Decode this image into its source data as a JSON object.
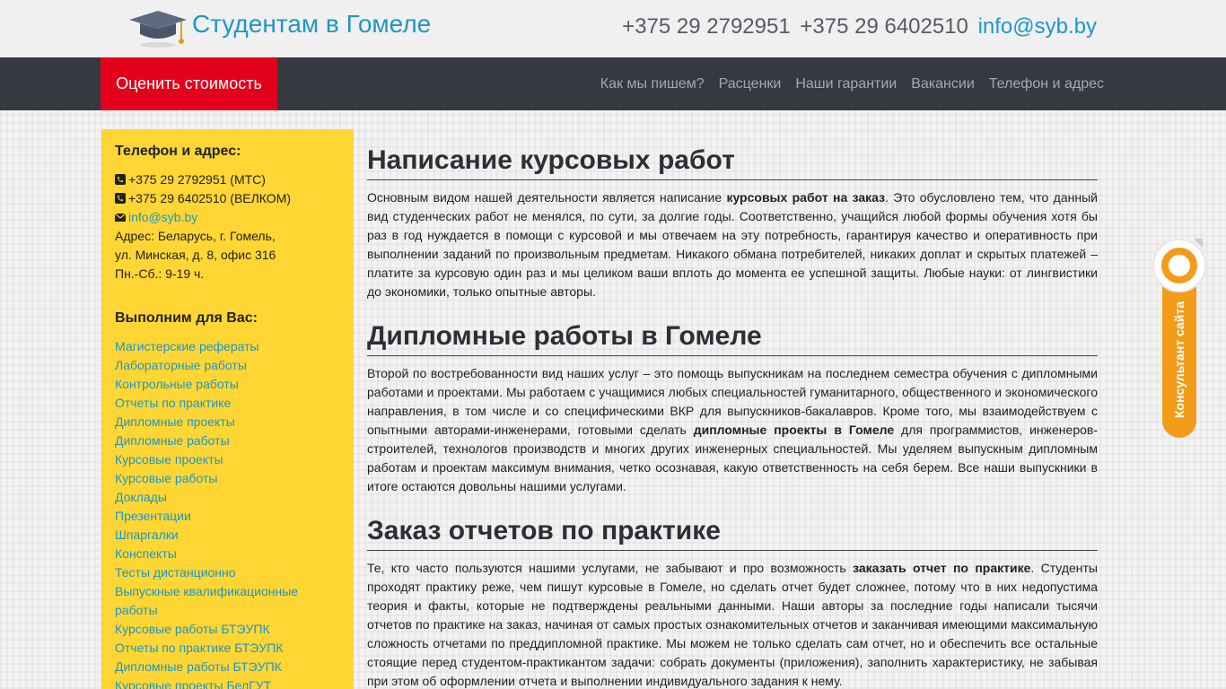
{
  "header": {
    "site_title": "Студентам в Гомеле",
    "phone1": "+375 29 2792951",
    "phone2": "+375 29 6402510",
    "email": "info@syb.by"
  },
  "nav": {
    "cta": "Оценить стоимость",
    "links": [
      "Как мы пишем?",
      "Расценки",
      "Наши гарантии",
      "Вакансии",
      "Телефон и адрес"
    ]
  },
  "sidebar": {
    "contact_heading": "Телефон и адрес:",
    "phone1": "+375 29 2792951 (МТС)",
    "phone2": "+375 29 6402510 (ВЕЛКОМ)",
    "email": "info@syb.by",
    "address1": "Адрес: Беларусь, г. Гомель,",
    "address2": "ул. Минская, д. 8, офис 316",
    "hours": "Пн.-Сб.: 9-19 ч.",
    "services_heading": "Выполним для Вас:",
    "services": [
      "Магистерские рефераты",
      "Лабораторные работы",
      "Контрольные работы",
      "Отчеты по практике",
      "Дипломные проекты",
      "Дипломные работы",
      "Курсовые проекты",
      "Курсовые работы",
      "Доклады",
      "Презентации",
      "Шпаргалки",
      "Конспекты",
      "Тесты дистанционно",
      "Выпускные квалификационные работы",
      "Курсовые работы БТЭУПК",
      "Отчеты по практике БТЭУПК",
      "Дипломные работы БТЭУПК",
      "Курсовые проекты БелГУТ"
    ]
  },
  "content": {
    "s1": {
      "title": "Написание курсовых работ",
      "t1": "Основным видом нашей деятельности является написание ",
      "b1": "курсовых работ на заказ",
      "t2": ". Это обусловлено тем, что данный вид студенческих работ не менялся, по сути, за долгие годы. Соответственно, учащийся любой формы обучения хотя бы раз в год нуждается в помощи с курсовой и мы отвечаем на эту потребность, гарантируя качество и оперативность при выполнении заданий по произвольным предметам. Никакого обмана потребителей, никаких доплат и скрытых платежей – платите за курсовую один раз и мы целиком ваши вплоть до момента ее успешной защиты. Любые науки: от лингвистики до экономики, только опытные авторы."
    },
    "s2": {
      "title": "Дипломные работы в Гомеле",
      "t1": "Второй по востребованности вид наших услуг – это помощь выпускникам на последнем семестра обучения с дипломными работами и проектами. Мы работаем с учащимися любых специальностей гуманитарного, общественного и экономического направления, в том числе и со специфическими ВКР для выпускников-бакалавров. Кроме того, мы взаимодействуем с опытными авторами-инженерами, готовыми сделать ",
      "b1": "дипломные проекты в Гомеле",
      "t2": " для программистов, инженеров-строителей, технологов производств и многих других инженерных специальностей. Мы уделяем выпускным дипломным работам и проектам максимум внимания, четко осознавая, какую ответственность на себя берем. Все наши выпускники в итоге остаются довольны нашими услугами."
    },
    "s3": {
      "title": "Заказ отчетов по практике",
      "t1": "Те, кто часто пользуются нашими услугами, не забывают и про возможность ",
      "b1": "заказать отчет по практике",
      "t2": ". Студенты проходят практику реже, чем пишут курсовые в Гомеле, но сделать отчет будет сложнее, потому что в них недопустима теория и факты, которые не подтверждены реальными данными. Наши авторы за последние годы написали тысячи отчетов по практике на заказ, начиная от самых простых ознакомительных отчетов и заканчивая имеющими максимальную сложность отчетами по преддипломной практике. Мы можем не только сделать сам отчет, но и обеспечить все остальные стоящие перед студентом-практикантом задачи: собрать документы (приложения), заполнить характеристику, не забывая при этом об оформлении отчета и выполнении индивидуального задания к нему."
    }
  },
  "widget": {
    "label": "Консультант сайта"
  },
  "colors": {
    "accent": "#1e96c8",
    "cta": "#e3001b",
    "navbar": "#343a40",
    "sidebar": "#ffd633",
    "widget": "#f39c1a"
  },
  "icons": {
    "logo": "graduation-cap-icon",
    "phone": "phone-square-icon",
    "email": "envelope-icon",
    "widget": "ring-icon"
  }
}
